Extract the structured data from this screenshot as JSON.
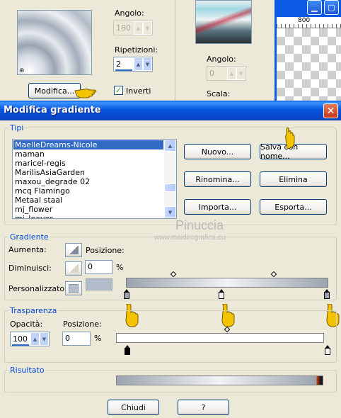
{
  "background_window": {
    "angle_label": "Angolo:",
    "angle_value": "180",
    "repetitions_label": "Ripetizioni:",
    "repetitions_value": "2",
    "modify_button": "Modifica...",
    "invert_label": "Inverti",
    "angle2_label": "Angolo:",
    "angle2_value": "0",
    "scale_label": "Scala:",
    "ruler_value": "800"
  },
  "dialog": {
    "title": "Modifica gradiente",
    "close_glyph": "✕",
    "types_group": {
      "legend": "Tipi",
      "items": [
        {
          "label": "MaelleDreams-Nicole",
          "selected": true
        },
        {
          "label": "maman",
          "selected": false
        },
        {
          "label": "maricel-regis",
          "selected": false
        },
        {
          "label": "MarilisAsiaGarden",
          "selected": false
        },
        {
          "label": "maxou_degrade 02",
          "selected": false
        },
        {
          "label": "mcq Flamingo",
          "selected": false
        },
        {
          "label": "Metaal staal",
          "selected": false
        },
        {
          "label": "mj_flower",
          "selected": false
        },
        {
          "label": "mj_leaves",
          "selected": false
        }
      ],
      "buttons": {
        "new": "Nuovo...",
        "save_as": "Salva con nome...",
        "rename": "Rinomina...",
        "delete": "Elimina",
        "import": "Importa...",
        "export": "Esporta..."
      }
    },
    "watermark": {
      "title": "Pinuccia",
      "url": "www.maidiregrafica.eu"
    },
    "gradient_group": {
      "legend": "Gradiente",
      "increase_label": "Aumenta:",
      "position_label": "Posizione:",
      "decrease_label": "Diminuisci:",
      "position_value": "0",
      "percent": "%",
      "custom_label": "Personalizzato:",
      "custom_color": "#b2bccb",
      "stops": [
        0,
        50,
        100
      ],
      "midpoints": [
        50,
        50
      ]
    },
    "transparency_group": {
      "legend": "Trasparenza",
      "opacity_label": "Opacità:",
      "opacity_value": "100",
      "position_label": "Posizione:",
      "position_value": "0",
      "percent": "%",
      "stops": [
        0,
        100
      ],
      "midpoints": [
        50
      ]
    },
    "result_group": {
      "legend": "Risultato"
    },
    "footer": {
      "close": "Chiudi",
      "help": "?"
    }
  },
  "colors": {
    "title_bar": "#0a5ae6",
    "selection": "#316ac5",
    "group_legend": "#0046d5"
  },
  "icons": [
    "hand-pointer-icon",
    "check-icon",
    "minimize-icon",
    "maximize-icon",
    "close-icon",
    "spin-up-icon",
    "spin-down-icon"
  ]
}
